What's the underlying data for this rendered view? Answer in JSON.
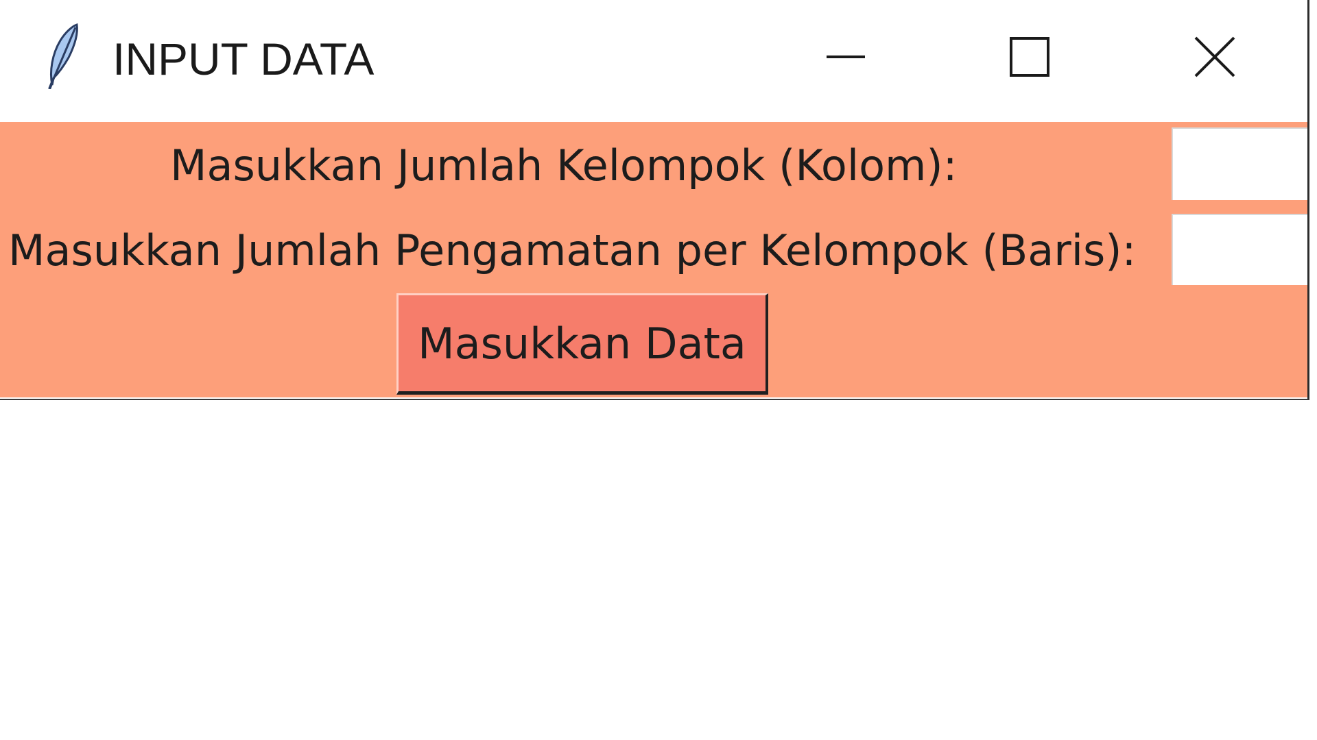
{
  "window": {
    "title": "INPUT DATA",
    "app_icon": "feather-icon",
    "controls": {
      "minimize_icon": "minimize-icon",
      "maximize_icon": "maximize-icon",
      "close_icon": "close-icon"
    }
  },
  "form": {
    "kolom_label": "Masukkan Jumlah Kelompok (Kolom):",
    "kolom_value": "",
    "baris_label": "Masukkan Jumlah Pengamatan per Kelompok (Baris):",
    "baris_value": "",
    "submit_label": "Masukkan Data"
  },
  "colors": {
    "background": "#fd9f7a",
    "button": "#f67d6b",
    "entry": "#ffffff"
  }
}
